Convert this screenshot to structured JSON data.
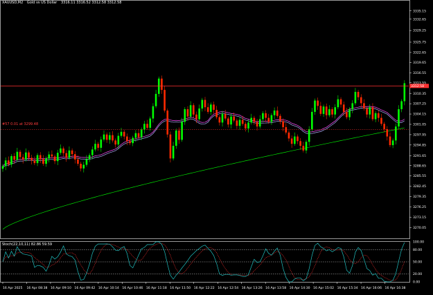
{
  "header": {
    "symbol": "XAUUSD,M2",
    "description": "Gold vs US Dollar",
    "ohlc": "3316.11 3316.52 3312.58 3312.58"
  },
  "trade_label": "#57 0.01 at 3299.48",
  "indicator_header": "Stoch(22,10,11) 82.86 59.59",
  "current_price_tag": "3312.58",
  "colors": {
    "background": "#000000",
    "bull_candle": "#00ff00",
    "bear_candle": "#ff2a00",
    "ma_fast": "#ff4dff",
    "ma_medium": "#b0b0ff",
    "ma_slow": "#00e000",
    "resistance_line": "#ff3030",
    "stoch_main": "#20c0c0",
    "stoch_signal": "#ff3030",
    "grid": "#ffffff"
  },
  "chart_data": {
    "type": "candlestick",
    "price_axis_ticks": [
      "3335.15",
      "3332.65",
      "3329.25",
      "3325.75",
      "3322.65",
      "3319.65",
      "3316.55",
      "3313.55",
      "3310.35",
      "3307.25",
      "3304.15",
      "3301.05",
      "3297.95",
      "3294.85",
      "3291.65",
      "3288.65",
      "3285.55",
      "3282.45",
      "3279.35",
      "3276.25",
      "3273.15",
      "3270.05"
    ],
    "ylim": [
      3267.0,
      3338.0
    ],
    "stoch_axis_ticks": [
      "100.00",
      "80.00",
      "50.00",
      "20.00",
      "0.00"
    ],
    "stoch_levels": [
      80,
      50,
      20
    ],
    "time_axis_labels": [
      "16 Apr 2025",
      "16 Apr 08:38",
      "16 Apr 09:10",
      "16 Apr 09:42",
      "16 Apr 10:14",
      "16 Apr 10:46",
      "16 Apr 11:18",
      "16 Apr 11:50",
      "16 Apr 12:22",
      "16 Apr 12:54",
      "16 Apr 13:26",
      "16 Apr 13:58",
      "16 Apr 14:30",
      "16 Apr 15:02",
      "16 Apr 15:34",
      "16 Apr 16:06",
      "16 Apr 16:38"
    ],
    "resistance_level": 3312.6,
    "trade_level": 3299.48,
    "closes": [
      3288.5,
      3290.2,
      3289.0,
      3291.5,
      3290.4,
      3292.8,
      3291.2,
      3290.5,
      3292.6,
      3291.0,
      3290.2,
      3289.4,
      3291.8,
      3290.6,
      3289.2,
      3290.8,
      3292.0,
      3291.4,
      3290.0,
      3292.5,
      3293.8,
      3292.4,
      3291.0,
      3293.2,
      3292.1,
      3290.5,
      3289.2,
      3287.8,
      3288.9,
      3290.6,
      3291.8,
      3293.5,
      3295.2,
      3294.0,
      3296.5,
      3298.0,
      3296.4,
      3297.8,
      3296.2,
      3295.0,
      3297.6,
      3298.8,
      3297.4,
      3296.0,
      3295.4,
      3297.0,
      3298.4,
      3297.2,
      3299.5,
      3301.2,
      3300.0,
      3302.8,
      3306.5,
      3310.2,
      3314.8,
      3311.4,
      3305.2,
      3298.0,
      3290.8,
      3294.6,
      3299.2,
      3296.4,
      3301.8,
      3305.6,
      3303.4,
      3306.8,
      3304.0,
      3302.6,
      3305.8,
      3308.4,
      3306.2,
      3304.8,
      3307.0,
      3305.4,
      3303.2,
      3301.6,
      3304.2,
      3302.8,
      3301.0,
      3303.4,
      3302.2,
      3300.6,
      3302.4,
      3301.2,
      3299.8,
      3301.6,
      3303.0,
      3301.8,
      3300.4,
      3302.6,
      3304.4,
      3303.0,
      3301.8,
      3303.8,
      3305.2,
      3303.6,
      3302.0,
      3300.2,
      3298.6,
      3296.8,
      3295.2,
      3297.4,
      3296.0,
      3294.6,
      3293.2,
      3295.8,
      3299.6,
      3304.8,
      3308.2,
      3306.6,
      3304.2,
      3306.4,
      3303.8,
      3305.6,
      3304.0,
      3306.2,
      3308.6,
      3307.0,
      3304.8,
      3303.2,
      3305.6,
      3307.4,
      3310.8,
      3309.2,
      3307.4,
      3305.8,
      3304.0,
      3306.2,
      3302.6,
      3304.4,
      3303.0,
      3301.2,
      3299.6,
      3297.4,
      3294.8,
      3296.2,
      3300.4,
      3305.6,
      3308.0,
      3313.4
    ]
  }
}
